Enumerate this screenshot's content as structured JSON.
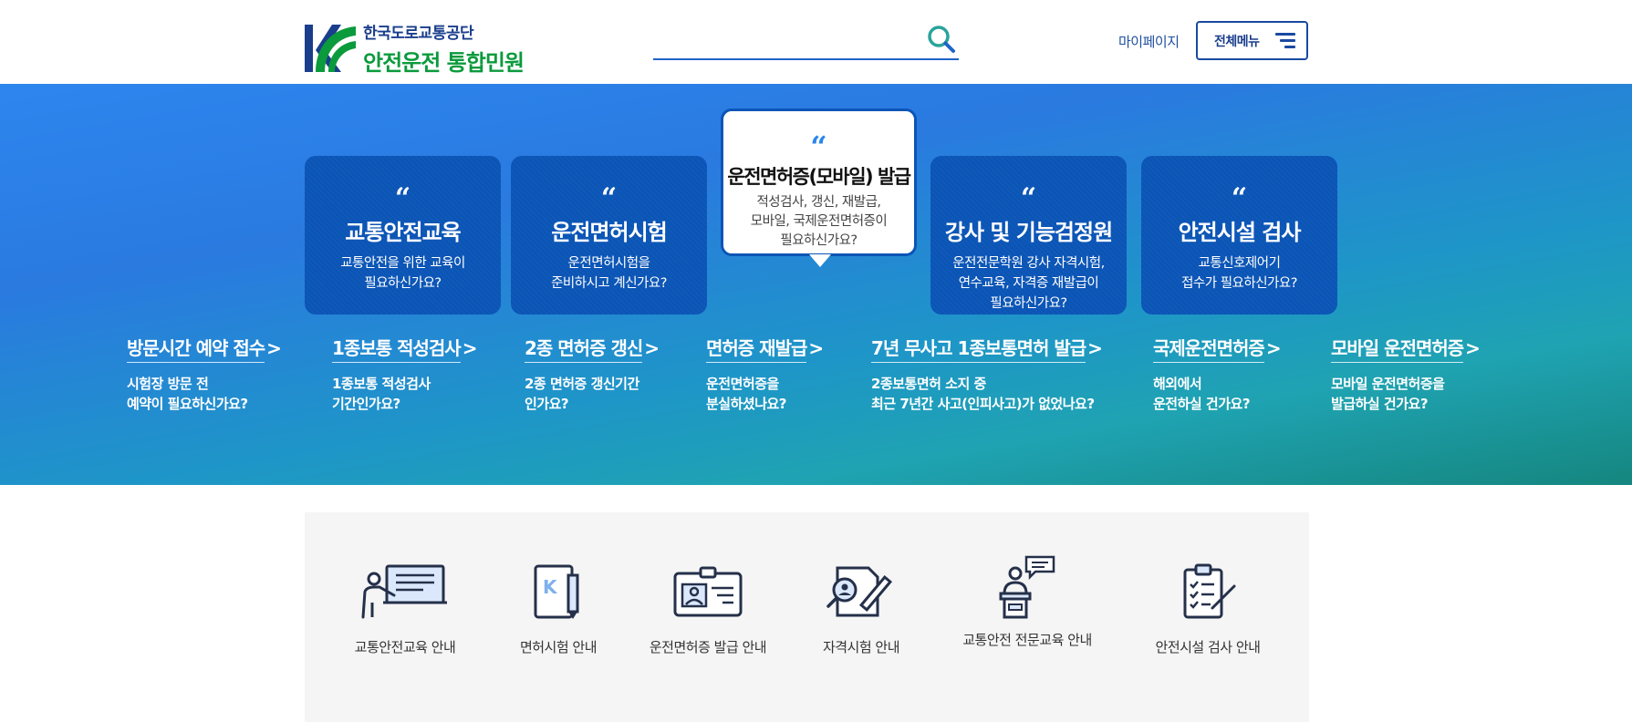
{
  "header": {
    "org_name": "한국도로교통공단",
    "site_name": "안전운전 통합민원",
    "search_placeholder": "",
    "mypage_label": "마이페이지",
    "allmenu_label": "전체메뉴"
  },
  "cards": [
    {
      "title": "교통안전교육",
      "desc": "교통안전을 위한 교육이\n필요하신가요?",
      "icon": "quote-icon"
    },
    {
      "title": "운전면허시험",
      "desc": "운전면허시험을\n준비하시고 계신가요?",
      "icon": "quote-icon"
    },
    {
      "title": "운전면허증(모바일) 발급",
      "desc": "적성검사, 갱신, 재발급,\n모바일, 국제운전면허증이\n필요하신가요?",
      "icon": "quote-icon",
      "active": true
    },
    {
      "title": "강사 및 기능검정원",
      "desc": "운전전문학원 강사 자격시험,\n연수교육, 자격증 재발급이\n필요하신가요?",
      "icon": "quote-icon"
    },
    {
      "title": "안전시설 검사",
      "desc": "교통신호제어기\n접수가 필요하신가요?",
      "icon": "quote-icon"
    }
  ],
  "quick_links": [
    {
      "title": "방문시간 예약 접수",
      "desc": "시험장 방문 전\n예약이 필요하신가요?"
    },
    {
      "title": "1종보통 적성검사",
      "desc": "1종보통 적성검사\n기간인가요?"
    },
    {
      "title": "2종 면허증 갱신",
      "desc": "2종 면허증 갱신기간\n인가요?"
    },
    {
      "title": "면허증 재발급",
      "desc": "운전면허증을\n분실하셨나요?"
    },
    {
      "title": "7년 무사고 1종보통면허 발급",
      "desc": "2종보통면허 소지 중\n최근 7년간 사고(인피사고)가 없었나요?"
    },
    {
      "title": "국제운전면허증",
      "desc": "해외에서\n운전하실 건가요?"
    },
    {
      "title": "모바일 운전면허증",
      "desc": "모바일 운전면허증을\n발급하실 건가요?"
    }
  ],
  "services": [
    {
      "label": "교통안전교육 안내",
      "icon": "presentation-board-icon"
    },
    {
      "label": "면허시험 안내",
      "icon": "exam-pencil-icon"
    },
    {
      "label": "운전면허증 발급 안내",
      "icon": "id-card-icon"
    },
    {
      "label": "자격시험 안내",
      "icon": "certificate-search-icon"
    },
    {
      "label": "교통안전 전문교육 안내",
      "icon": "lecturer-podium-icon"
    },
    {
      "label": "안전시설 검사 안내",
      "icon": "checklist-clipboard-icon"
    }
  ],
  "colors": {
    "brand_blue": "#1a3e8c",
    "brand_green": "#0b9a3c",
    "card_blue": "#0b55b6",
    "accent_blue": "#2b86ea"
  }
}
